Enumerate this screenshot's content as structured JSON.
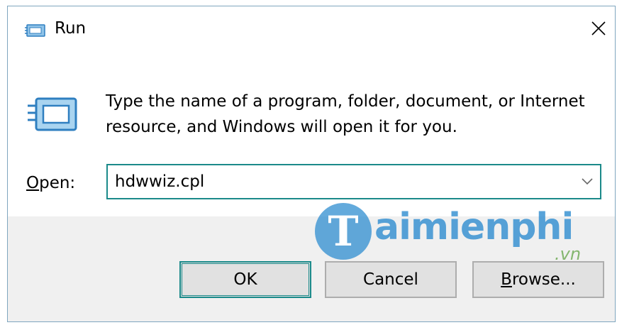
{
  "window": {
    "title": "Run",
    "close_glyph": "✕"
  },
  "body": {
    "description_line1": "Type the name of a program, folder, document, or Internet",
    "description_line2": "resource, and Windows will open it for you.",
    "open_label_mnemonic": "O",
    "open_label_rest": "pen:",
    "open_value": "hdwwiz.cpl"
  },
  "buttons": {
    "ok": "OK",
    "cancel": "Cancel",
    "browse_mnemonic": "B",
    "browse_rest": "rowse..."
  },
  "watermark": {
    "letter": "T",
    "text": "aimienphi",
    "suffix": ".vn"
  },
  "colors": {
    "accent": "#1b8a8a",
    "icon_blue": "#2f8dd0",
    "footer_bg": "#f0f0f0",
    "button_bg": "#e1e1e1"
  },
  "icons": [
    "run-icon",
    "close-icon",
    "chevron-down-icon"
  ]
}
